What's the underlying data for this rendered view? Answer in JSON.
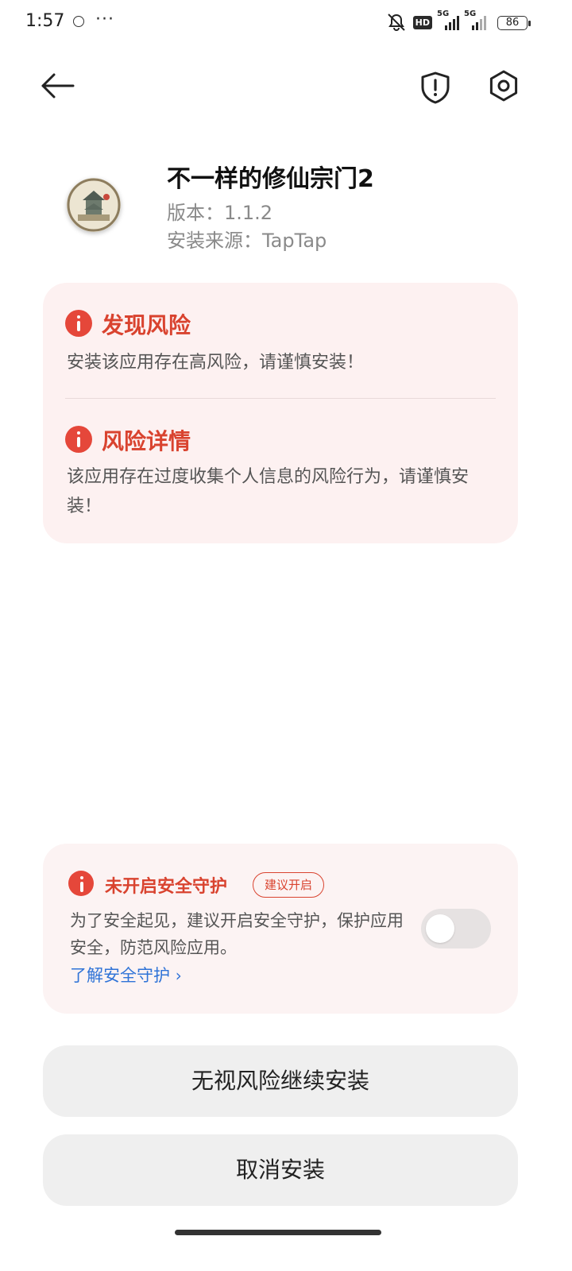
{
  "status_bar": {
    "time": "1:57",
    "dots": "···",
    "hd": "HD",
    "net1": "5G",
    "net2": "5G",
    "battery": "86"
  },
  "icons": {
    "back": "back-arrow-icon",
    "shield": "shield-alert-icon",
    "settings": "settings-hex-icon",
    "risk": "info-alert-icon"
  },
  "app": {
    "name": "不一样的修仙宗门2",
    "version": "版本：1.1.2",
    "source": "安装来源：TapTap"
  },
  "risk_card": {
    "found_title": "发现风险",
    "found_body": "安装该应用存在高风险，请谨慎安装！",
    "detail_title": "风险详情",
    "detail_body": "该应用存在过度收集个人信息的风险行为，请谨慎安装！"
  },
  "guard": {
    "title": "未开启安全守护",
    "badge": "建议开启",
    "body": "为了安全起见，建议开启安全守护，保护应用安全，防范风险应用。",
    "link": "了解安全守护",
    "toggle_on": false
  },
  "buttons": {
    "continue": "无视风险继续安装",
    "cancel": "取消安装"
  },
  "colors": {
    "accent_red": "#d9432f",
    "link_blue": "#2f73d7",
    "card_bg": "#fdf1f1"
  }
}
